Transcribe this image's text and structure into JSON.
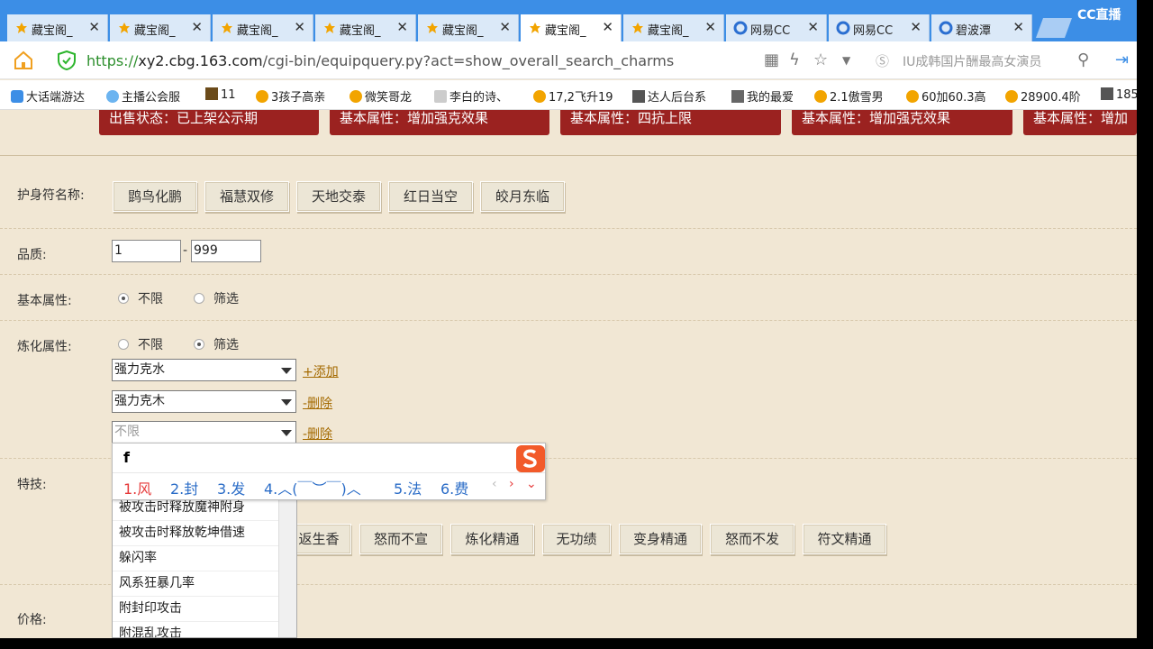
{
  "tabs": [
    {
      "label": "藏宝阁_",
      "icon": "cbg-icon",
      "close": "✕"
    },
    {
      "label": "藏宝阁_",
      "icon": "cbg-icon",
      "close": "✕"
    },
    {
      "label": "藏宝阁_",
      "icon": "cbg-icon",
      "close": "✕"
    },
    {
      "label": "藏宝阁_",
      "icon": "cbg-icon",
      "close": "✕"
    },
    {
      "label": "藏宝阁_",
      "icon": "cbg-icon",
      "close": "✕"
    },
    {
      "label": "藏宝阁_",
      "icon": "cbg-icon",
      "close": "✕",
      "active": true
    },
    {
      "label": "藏宝阁_",
      "icon": "cbg-icon",
      "close": "✕"
    },
    {
      "label": "网易CC",
      "icon": "netease-cc-icon",
      "close": "✕"
    },
    {
      "label": "网易CC",
      "icon": "netease-cc-icon",
      "close": "✕"
    },
    {
      "label": "碧波潭",
      "icon": "netease-cc-icon",
      "close": "✕"
    }
  ],
  "overlay_logo": "CC直播",
  "address": {
    "scheme": "https://",
    "host": "xy2.cbg.163.com",
    "path": "/cgi-bin/equipquery.py?act=show_overall_search_charms",
    "search_placeholder": "IU成韩国片酬最高女演员"
  },
  "bookmarks": [
    {
      "label": "大话端游达",
      "icon": "dahua-icon"
    },
    {
      "label": "主播公会服",
      "icon": "guild-icon"
    },
    {
      "label": "11",
      "icon": "game-icon"
    },
    {
      "label": "3孩子高亲",
      "icon": "cbg-icon"
    },
    {
      "label": "微笑哥龙",
      "icon": "cbg-icon"
    },
    {
      "label": "李白的诗、",
      "icon": "baidu-icon"
    },
    {
      "label": "17,2飞升19",
      "icon": "cbg-icon"
    },
    {
      "label": "达人后台系",
      "icon": "doc-icon"
    },
    {
      "label": "我的最爱",
      "icon": "grid-icon"
    },
    {
      "label": "2.1傲雪男",
      "icon": "cbg-icon"
    },
    {
      "label": "60加60.3高",
      "icon": "cbg-icon"
    },
    {
      "label": "28900.4阶",
      "icon": "cbg-icon"
    },
    {
      "label": "185",
      "icon": "doc-icon"
    }
  ],
  "top_cards": [
    "出售状态：已上架公示期",
    "基本属性：增加强克效果",
    "基本属性：四抗上限",
    "基本属性：增加强克效果",
    "基本属性：增加"
  ],
  "form": {
    "name_label": "护身符名称:",
    "name_buttons": [
      "鹍鸟化鹏",
      "福慧双修",
      "天地交泰",
      "红日当空",
      "皎月东临"
    ],
    "quality_label": "品质:",
    "quality_min": "1",
    "quality_sep": "-",
    "quality_max": "999",
    "basic_label": "基本属性:",
    "basic_options": [
      "不限",
      "筛选"
    ],
    "refine_label": "炼化属性:",
    "refine_options": [
      "不限",
      "筛选"
    ],
    "refine_selects": [
      {
        "value": "强力克水",
        "link": "+添加"
      },
      {
        "value": "强力克木",
        "link": "-删除"
      },
      {
        "value": "不限",
        "link": "-删除"
      }
    ],
    "skill_label": "特技:",
    "skill_buttons": [
      "返生香",
      "怒而不宣",
      "炼化精通",
      "无功绩",
      "变身精通",
      "怒而不发",
      "符文精通"
    ],
    "price_label": "价格:"
  },
  "dropdown_options": [
    "被攻击时释放魔神附身",
    "被攻击时释放乾坤借速",
    "躲闪率",
    "风系狂暴几率",
    "附封印攻击",
    "附混乱攻击"
  ],
  "ime": {
    "input": "f",
    "candidates": [
      "1.风",
      "2.封",
      "3.发",
      "4.︿(￣︶￣)︿",
      "5.法",
      "6.费"
    ],
    "prev": "‹",
    "next": "›",
    "expand": "⌄"
  },
  "colors": {
    "tabbar": "#3c8ee6",
    "page_bg": "#f1e7d4",
    "card_bg": "#9b2220",
    "link": "#a46a00",
    "ime_first": "#e63a3a",
    "ime_cand": "#2a6cc7"
  }
}
